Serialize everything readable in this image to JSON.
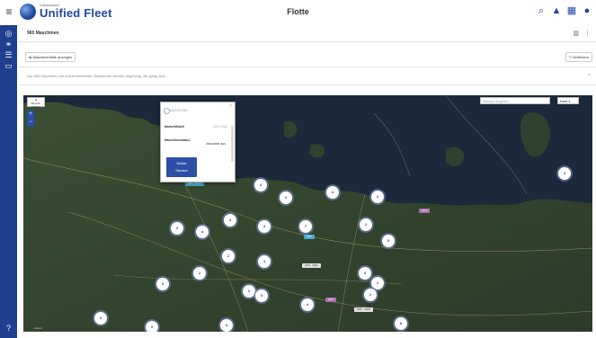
{
  "app": {
    "brand_small": "Volkswasser",
    "brand": "Unified Fleet",
    "page_title": "Flotte"
  },
  "header_icons": [
    "search-icon",
    "alert-icon",
    "grid-icon",
    "user-icon"
  ],
  "sidenav_icons": [
    "compass-icon",
    "link-icon",
    "list-icon",
    "card-icon",
    "help-icon"
  ],
  "content": {
    "machines_title": "965 Maschinen",
    "show_machinelist_label": "Maschinenliste anzeigen",
    "filter_label": "Verfeinern",
    "info_text": "Nur 965 Maschinen mit zuletzt bekannten Standorten werden angezeigt, die gültig sind."
  },
  "map": {
    "search_placeholder": "Standort eingeben",
    "map_type": "Karte",
    "area_select_label": "Bereich wählen",
    "zoom_in": "+",
    "zoom_out": "−",
    "attribution": "Karten",
    "clusters": [
      "4",
      "3",
      "4",
      "2",
      "4",
      "3",
      "2",
      "4",
      "7",
      "2",
      "3",
      "2",
      "4",
      "2",
      "3",
      "4",
      "2",
      "2",
      "3",
      "2",
      "4",
      "3",
      "4",
      "8",
      "2",
      "3"
    ],
    "tags": [
      {
        "text": "AP1 · 5134",
        "color": "#47a7c9"
      },
      {
        "text": "AP2",
        "color": "#47a7c9"
      },
      {
        "text": "AP3 · 4211",
        "color": "#e0e0e0"
      },
      {
        "text": "AP4",
        "color": "#b06fb3"
      },
      {
        "text": "AP5",
        "color": "#b06fb3"
      },
      {
        "text": "AP6 · 3320",
        "color": "#e0e0e0"
      }
    ]
  },
  "popup": {
    "location": "NACHFORD",
    "brand_model_label": "Marke/Modell",
    "brand_model_value": "CAT 3 hl/1",
    "status_label": "Maschinenstatus",
    "status_value": "Maschine aus",
    "details_label": "Details",
    "location_button": "Standort"
  },
  "colors": {
    "brand": "#1f4aa0",
    "sidenav": "#1f3f8f",
    "cluster_ring": "#788cc8"
  }
}
